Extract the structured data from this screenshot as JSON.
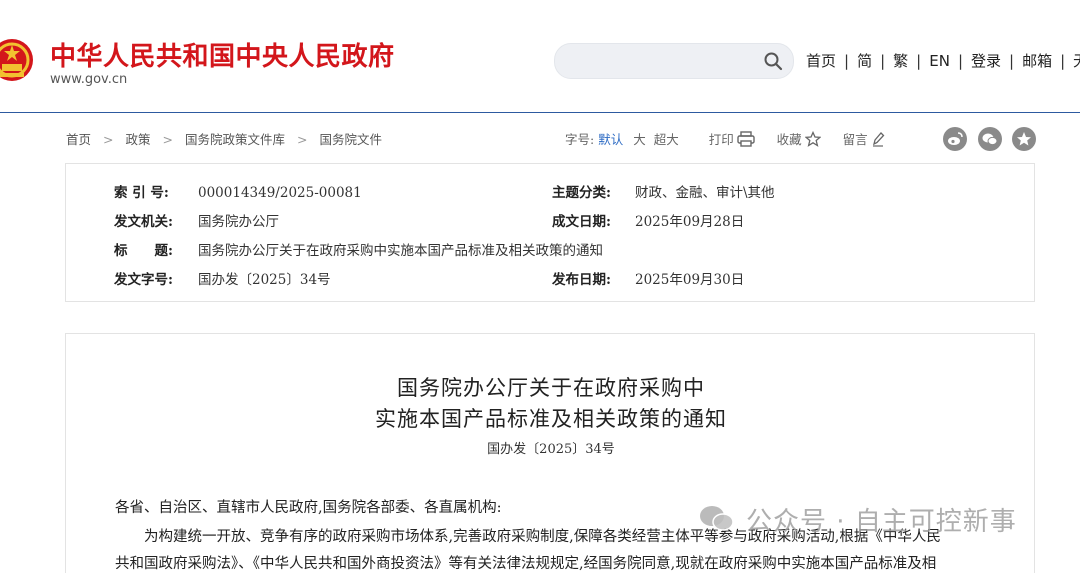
{
  "header": {
    "site_title": "中华人民共和国中央人民政府",
    "site_url": "www.gov.cn",
    "search_placeholder": "",
    "nav": [
      "首页",
      "简",
      "繁",
      "EN",
      "登录",
      "邮箱",
      "无"
    ]
  },
  "breadcrumb": [
    "首页",
    "政策",
    "国务院政策文件库",
    "国务院文件"
  ],
  "tools": {
    "font_label": "字号:",
    "font_default": "默认",
    "font_large": "大",
    "font_xlarge": "超大",
    "print": "打印",
    "favorite": "收藏",
    "comment": "留言"
  },
  "share_icons": [
    "weibo-icon",
    "wechat-icon",
    "star-icon"
  ],
  "info": {
    "index_label": "索 引 号:",
    "index_value": "000014349/2025-00081",
    "topic_label": "主题分类:",
    "topic_value": "财政、金融、审计\\其他",
    "issuer_label": "发文机关:",
    "issuer_value": "国务院办公厅",
    "date_written_label": "成文日期:",
    "date_written_value": "2025年09月28日",
    "title_label": "标　　题:",
    "title_value": "国务院办公厅关于在政府采购中实施本国产品标准及相关政策的通知",
    "docno_label": "发文字号:",
    "docno_value": "国办发〔2025〕34号",
    "pub_date_label": "发布日期:",
    "pub_date_value": "2025年09月30日"
  },
  "article": {
    "title_line1": "国务院办公厅关于在政府采购中",
    "title_line2": "实施本国产品标准及相关政策的通知",
    "doc_number": "国办发〔2025〕34号",
    "salutation": "各省、自治区、直辖市人民政府,国务院各部委、各直属机构:",
    "para1_line1": "为构建统一开放、竞争有序的政府采购市场体系,完善政府采购制度,保障各类经营主体平等参与政府采购活动,根据《中华人民",
    "para1_line2": "共和国政府采购法》、《中华人民共和国外商投资法》等有关法律法规规定,经国务院同意,现就在政府采购中实施本国产品标准及相"
  },
  "watermark": "公众号 · 自主可控新事",
  "colors": {
    "brand_red": "#d3161b",
    "link_blue": "#2d6bc4",
    "header_rule": "#2d5aa0"
  }
}
